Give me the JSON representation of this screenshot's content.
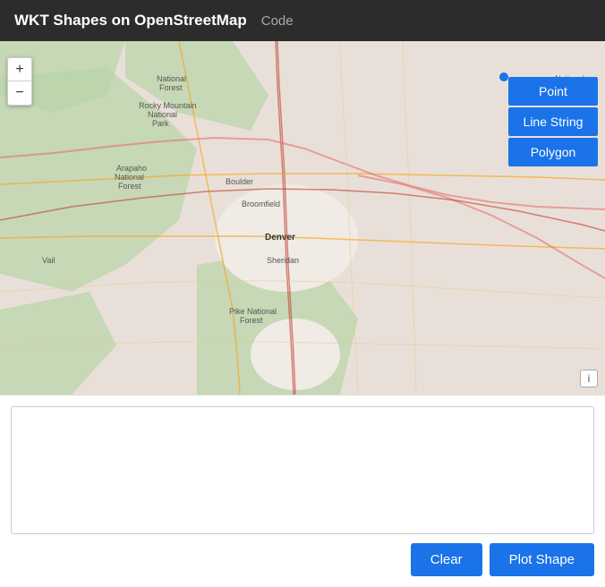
{
  "header": {
    "title": "WKT Shapes on OpenStreetMap",
    "code_label": "Code"
  },
  "map": {
    "zoom_in_label": "+",
    "zoom_out_label": "−",
    "info_label": "i",
    "blue_dot_visible": true,
    "shape_buttons": [
      {
        "label": "Point"
      },
      {
        "label": "Line String"
      },
      {
        "label": "Polygon"
      }
    ]
  },
  "bottom": {
    "textarea_placeholder": "",
    "clear_label": "Clear",
    "plot_label": "Plot Shape"
  }
}
